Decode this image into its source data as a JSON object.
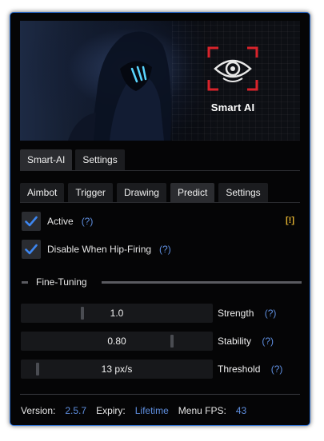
{
  "banner": {
    "brand_name": "Smart AI"
  },
  "main_tabs": [
    {
      "label": "Smart-AI",
      "active": true
    },
    {
      "label": "Settings",
      "active": false
    }
  ],
  "sub_tabs": [
    {
      "label": "Aimbot",
      "active": false
    },
    {
      "label": "Trigger",
      "active": false
    },
    {
      "label": "Drawing",
      "active": false
    },
    {
      "label": "Predict",
      "active": true
    },
    {
      "label": "Settings",
      "active": false
    }
  ],
  "options": {
    "active": {
      "label": "Active",
      "help": "(?)",
      "checked": true,
      "warning": "[!]"
    },
    "hipfire": {
      "label": "Disable When Hip-Firing",
      "help": "(?)",
      "checked": true
    }
  },
  "section": {
    "title": "Fine-Tuning"
  },
  "sliders": [
    {
      "value_text": "1.0",
      "label": "Strength",
      "help": "(?)",
      "level": 0.31
    },
    {
      "value_text": "0.80",
      "label": "Stability",
      "help": "(?)",
      "level": 0.81
    },
    {
      "value_text": "13 px/s",
      "label": "Threshold",
      "help": "(?)",
      "level": 0.06
    }
  ],
  "footer": {
    "version_label": "Version:",
    "version": "2.5.7",
    "expiry_label": "Expiry:",
    "expiry": "Lifetime",
    "fps_label": "Menu FPS:",
    "fps": "43"
  },
  "colors": {
    "accent": "#2a6fd6",
    "link": "#5f8fe0",
    "warning": "#e0b030",
    "logo_red": "#d9232b"
  }
}
